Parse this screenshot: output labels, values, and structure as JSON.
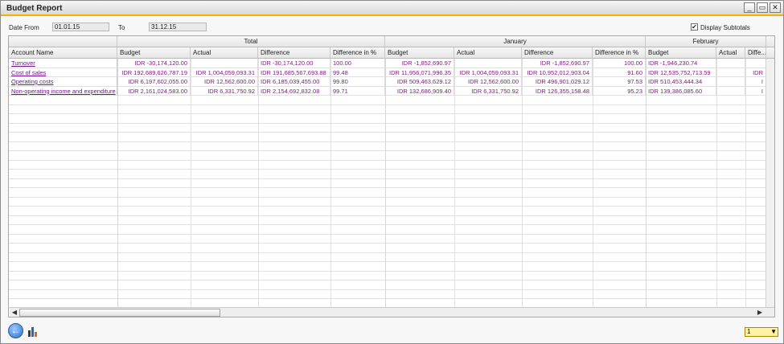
{
  "window": {
    "title": "Budget Report",
    "buttons": {
      "minimize": "_",
      "restore": "▭",
      "close": "✕"
    }
  },
  "params": {
    "date_from_label": "Date From",
    "date_from_value": "01.01.15",
    "to_label": "To",
    "to_value": "31.12.15",
    "subtotals_label": "Display Subtotals",
    "subtotals_checked": "✔"
  },
  "grid": {
    "groups": [
      "Total",
      "January",
      "February"
    ],
    "columns": [
      "Account Name",
      "Budget",
      "Actual",
      "Difference",
      "Difference in %",
      "Budget",
      "Actual",
      "Difference",
      "Difference in %",
      "Budget",
      "Actual",
      "Diffe..."
    ],
    "rows": [
      {
        "account": "Turnover",
        "cells": [
          "IDR -30,174,120.00",
          "",
          "IDR -30,174,120.00",
          "100.00",
          "IDR -1,852,690.97",
          "",
          "IDR -1,852,690.97",
          "100.00",
          "IDR -1,946,230.74",
          "",
          ""
        ]
      },
      {
        "account": "Cost of sales",
        "cells": [
          "IDR 192,689,626,787.19",
          "IDR 1,004,059,093.31",
          "IDR 191,685,567,693.88",
          "99.48",
          "IDR 11,956,071,996.35",
          "IDR 1,004,059,093.31",
          "IDR 10,952,012,903.04",
          "91.60",
          "IDR 12,535,752,713.59",
          "",
          "IDR"
        ]
      },
      {
        "account": "Operating costs",
        "cells": [
          "IDR 6,197,602,055.00",
          "IDR 12,562,600.00",
          "IDR 6,185,039,455.00",
          "99.80",
          "IDR 509,463,629.12",
          "IDR 12,562,600.00",
          "IDR 496,901,029.12",
          "97.53",
          "IDR 510,453,444.34",
          "",
          "I"
        ]
      },
      {
        "account": "Non-operating income and expenditure",
        "cells": [
          "IDR 2,161,024,583.00",
          "IDR 6,331,750.92",
          "IDR 2,154,692,832.08",
          "99.71",
          "IDR 132,686,909.40",
          "IDR 6,331,750.92",
          "IDR 126,355,158.48",
          "95.23",
          "IDR 139,386,085.60",
          "",
          "I"
        ]
      }
    ]
  },
  "footer": {
    "page_value": "1",
    "dropdown_arrow": "▼"
  }
}
